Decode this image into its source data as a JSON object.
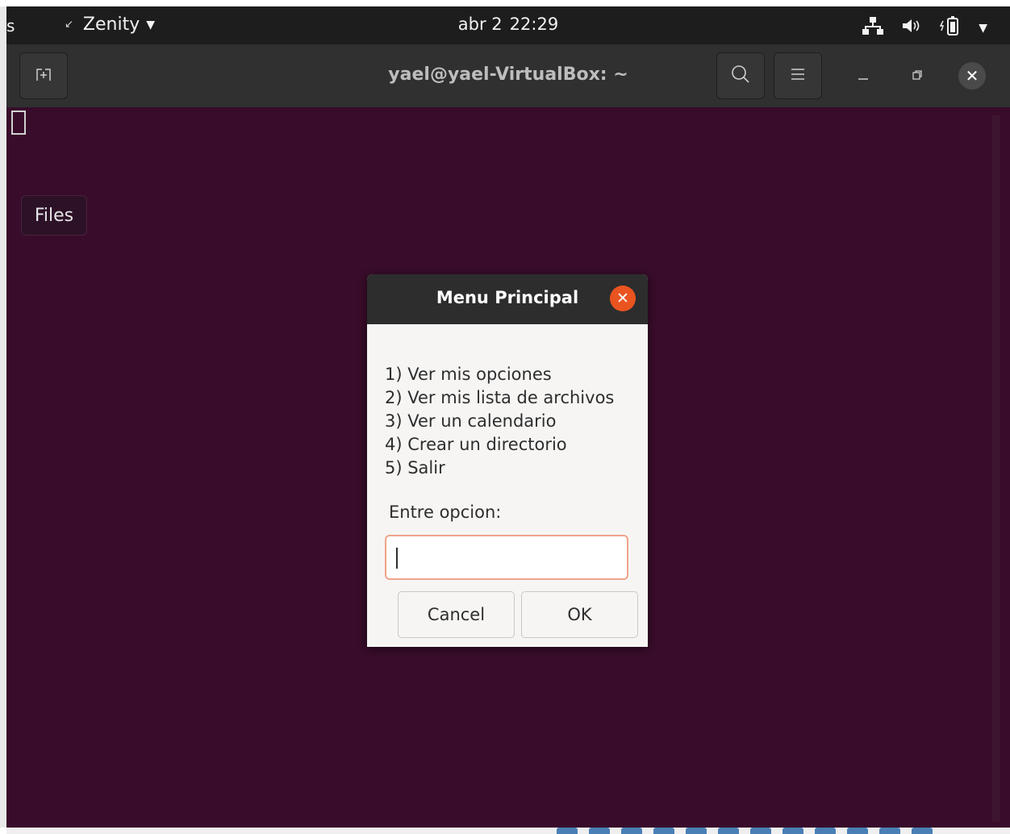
{
  "topbar": {
    "activities_fragment": "s",
    "app_name": "Zenity",
    "date": "abr 2",
    "time": "22:29",
    "tray_icons": [
      "network-icon",
      "volume-icon",
      "battery-icon",
      "system-menu-caret-icon"
    ]
  },
  "terminal": {
    "title": "yael@yael-VirtualBox: ~",
    "background": "#380c2a",
    "tooltip_label": "Files"
  },
  "dialog": {
    "title": "Menu Principal",
    "menu_lines": [
      "1) Ver mis opciones",
      "2) Ver mis lista de archivos",
      "3) Ver un calendario",
      "4) Crear un directorio",
      "5) Salir"
    ],
    "entry_label": "Entre opcion:",
    "entry_value": "",
    "cancel_label": "Cancel",
    "ok_label": "OK",
    "close_color": "#e95420"
  }
}
